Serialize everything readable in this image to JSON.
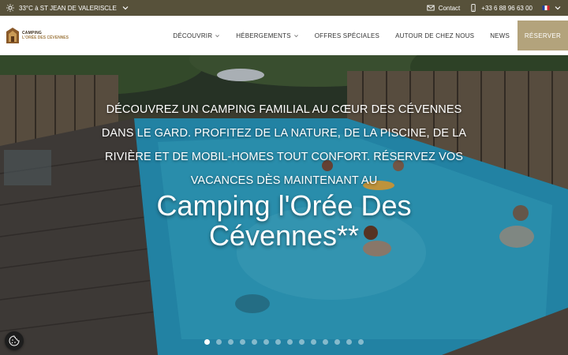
{
  "topbar": {
    "weather": "33°C à ST JEAN DE VALERISCLE",
    "contact": "Contact",
    "phone": "+33 6 88 96 63 00"
  },
  "nav": {
    "logo_line1": "CAMPING",
    "logo_line2": "L'ORÉE DES CÉVENNES",
    "items": [
      {
        "label": "DÉCOUVRIR",
        "dropdown": true
      },
      {
        "label": "HÉBERGEMENTS",
        "dropdown": true
      },
      {
        "label": "OFFRES SPÉCIALES",
        "dropdown": false
      },
      {
        "label": "AUTOUR DE CHEZ NOUS",
        "dropdown": false
      },
      {
        "label": "NEWS",
        "dropdown": false
      }
    ],
    "reserve": "RÉSERVER"
  },
  "hero": {
    "tagline": "DÉCOUVREZ UN CAMPING FAMILIAL AU CŒUR DES CÉVENNES DANS LE GARD. PROFITEZ DE LA NATURE, DE LA PISCINE, DE LA RIVIÈRE ET DE MOBIL-HOMES TOUT CONFORT. RÉSERVEZ VOS VACANCES DÈS MAINTENANT AU",
    "headline": "Camping l'Orée Des Cévennes**",
    "slides": 14,
    "active_slide": 0
  },
  "colors": {
    "topbar": "#57513a",
    "reserve": "#b3a37c",
    "water": "#2a9fc7"
  },
  "icons": [
    "sun-icon",
    "chevron-down-icon",
    "mail-icon",
    "phone-icon",
    "french-flag-icon",
    "cookie-icon"
  ]
}
